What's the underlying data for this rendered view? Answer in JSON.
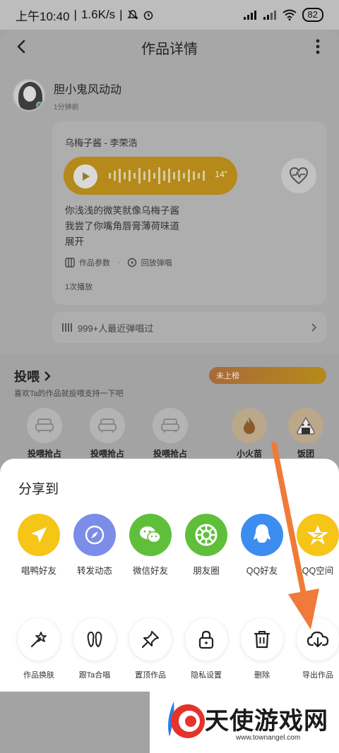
{
  "status_bar": {
    "time": "上午10:40",
    "speed": "1.6K/s",
    "battery": "82"
  },
  "header": {
    "title": "作品详情"
  },
  "author": {
    "name": "胆小鬼风动动",
    "time": "1分钟前"
  },
  "song": {
    "title": "乌梅子酱 - 李荣浩",
    "duration": "14\"",
    "lyrics": [
      "你浅浅的微笑就像乌梅子酱",
      "我尝了你嘴角唇膏薄荷味道",
      "展开"
    ],
    "params_label": "作品参数",
    "replay_label": "回放弹唱",
    "plays": "1次播放",
    "recent": "999+人最近弹唱过"
  },
  "feed": {
    "title": "投喂",
    "subtitle": "喜欢Ta的作品就投喂支持一下吧",
    "rank": "未上榜",
    "slots": [
      "投喂抢占",
      "投喂抢占",
      "投喂抢占"
    ],
    "gifts": [
      "小火苗",
      "饭团"
    ]
  },
  "share_sheet": {
    "title": "分享到",
    "targets": [
      {
        "label": "唱鸭好友",
        "color": "#f5c518",
        "icon": "send-icon"
      },
      {
        "label": "转发动态",
        "color": "#7b8de8",
        "icon": "compass-icon"
      },
      {
        "label": "微信好友",
        "color": "#5fbf3a",
        "icon": "wechat-icon"
      },
      {
        "label": "朋友圈",
        "color": "#5fbf3a",
        "icon": "moments-icon"
      },
      {
        "label": "QQ好友",
        "color": "#3b8df0",
        "icon": "qq-icon"
      },
      {
        "label": "QQ空间",
        "color": "#f5c518",
        "icon": "qzone-icon"
      }
    ],
    "actions": [
      {
        "label": "作品换肤",
        "icon": "magic-wand-icon"
      },
      {
        "label": "跟Ta合唱",
        "icon": "footprints-icon"
      },
      {
        "label": "置顶作品",
        "icon": "pin-icon"
      },
      {
        "label": "隐私设置",
        "icon": "lock-icon"
      },
      {
        "label": "删除",
        "icon": "trash-icon"
      },
      {
        "label": "导出作品",
        "icon": "cloud-download-icon"
      }
    ]
  },
  "watermark": {
    "brand": "天使游戏网",
    "url": "www.townangel.com"
  },
  "colors": {
    "annotation_arrow": "#f07a3a",
    "player": "#b58a1a"
  }
}
